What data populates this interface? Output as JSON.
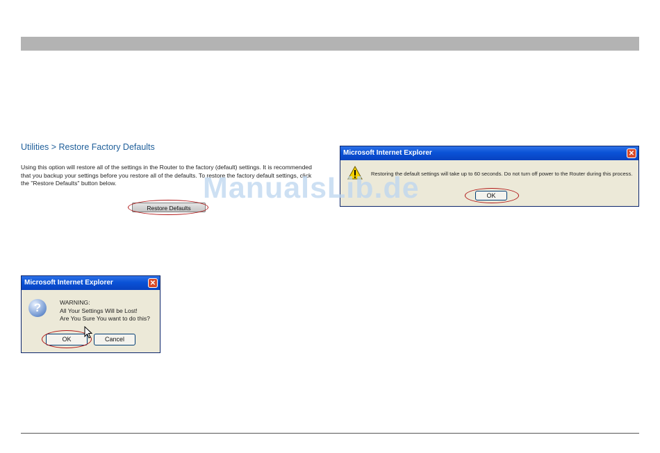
{
  "page": {
    "title": "Utilities > Restore Factory Defaults",
    "description": "Using this option will restore all of the settings in the Router to the factory (default) settings. It is recommended that you backup your settings before you restore all of the defaults. To restore the factory default settings, click the \"Restore Defaults\" button below.",
    "restore_button": "Restore Defaults"
  },
  "dialog_info": {
    "title": "Microsoft Internet Explorer",
    "close": "✕",
    "icon": "warning-icon",
    "message": "Restoring the default settings will take up to 60 seconds. Do not turn off power to the Router during this process.",
    "ok": "OK"
  },
  "dialog_confirm": {
    "title": "Microsoft Internet Explorer",
    "close": "✕",
    "icon": "question-icon",
    "icon_glyph": "?",
    "line1": "WARNING:",
    "line2": "All Your Settings Will be Lost!",
    "line3": "Are You Sure You want to do this?",
    "ok": "OK",
    "cancel": "Cancel"
  },
  "watermark": "ManualsLib.de",
  "colors": {
    "title_blue": "#1f5f9a",
    "highlight_red": "#b01515",
    "header_bar": "#b3b3b3"
  }
}
